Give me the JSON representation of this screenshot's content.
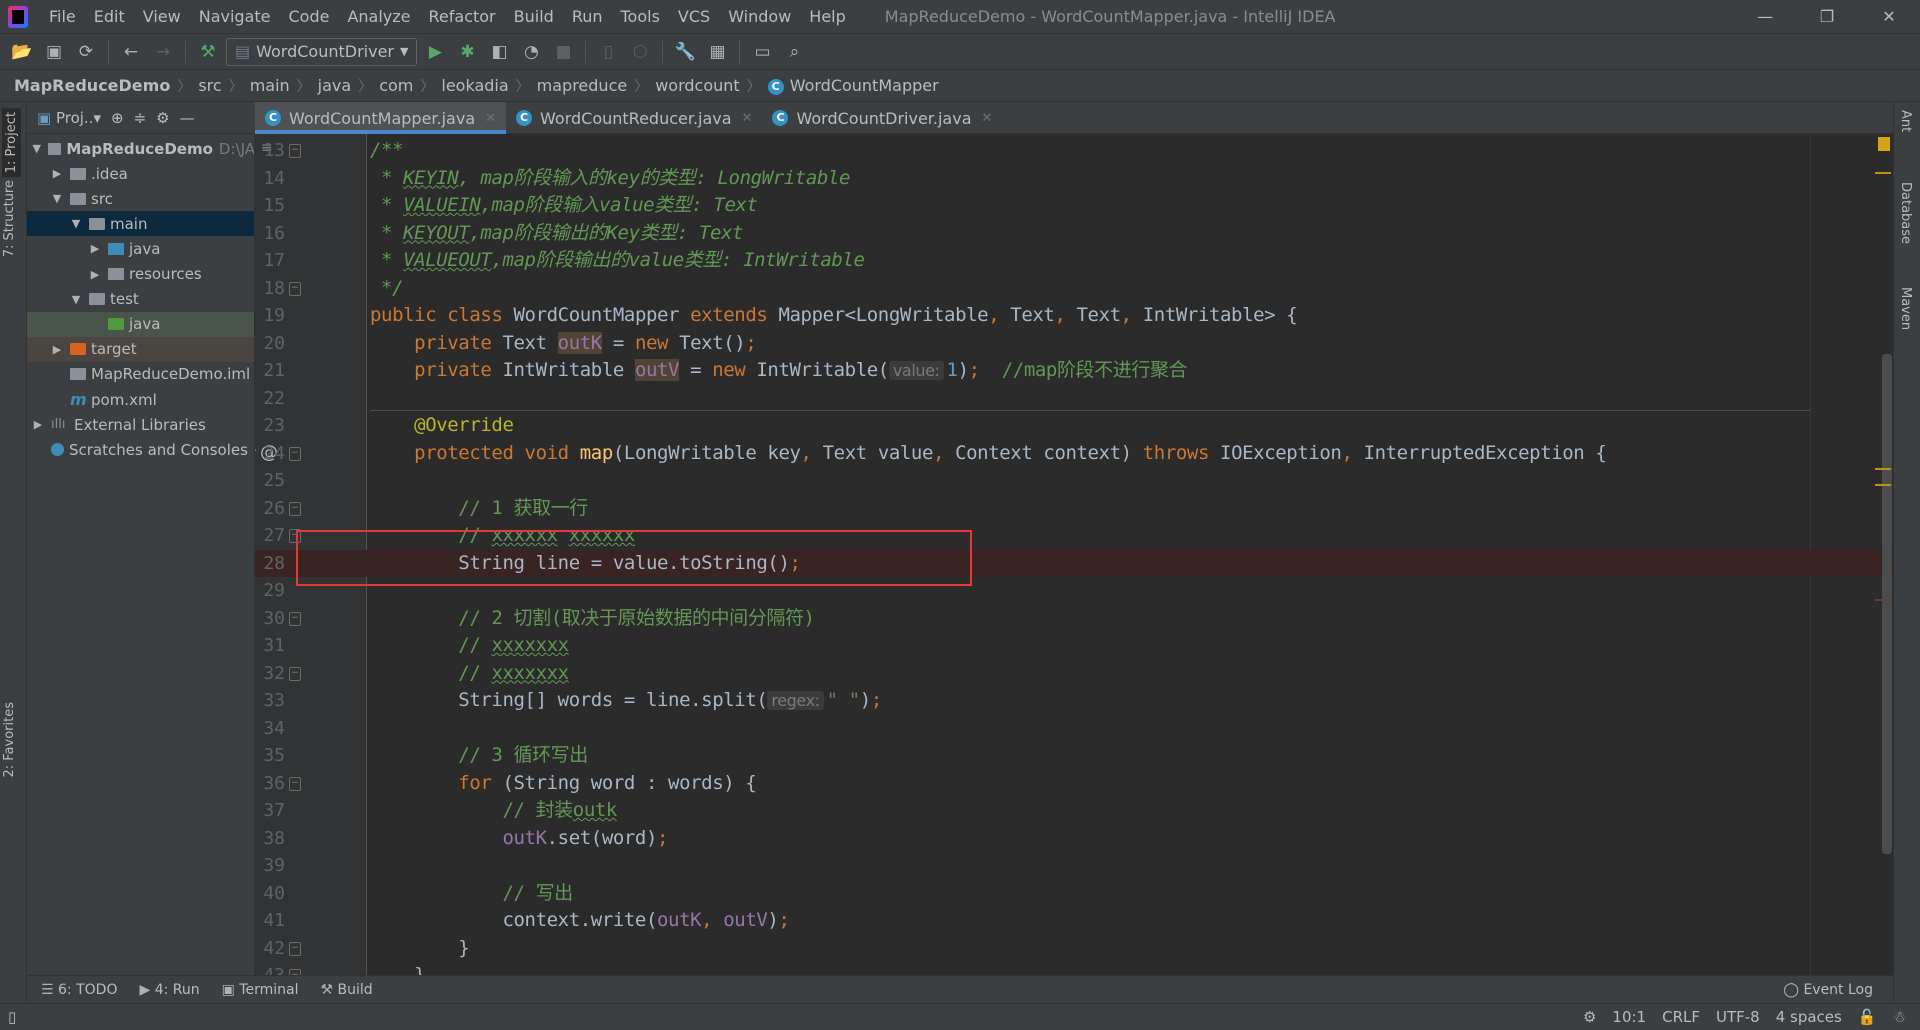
{
  "window": {
    "title": "MapReduceDemo - WordCountMapper.java - IntelliJ IDEA",
    "controls": [
      "—",
      "❐",
      "✕"
    ]
  },
  "menu": [
    "File",
    "Edit",
    "View",
    "Navigate",
    "Code",
    "Analyze",
    "Refactor",
    "Build",
    "Run",
    "Tools",
    "VCS",
    "Window",
    "Help"
  ],
  "toolbar": {
    "run_config": "WordCountDriver"
  },
  "breadcrumb": [
    "MapReduceDemo",
    "src",
    "main",
    "java",
    "com",
    "leokadia",
    "mapreduce",
    "wordcount",
    "WordCountMapper"
  ],
  "left_strip": {
    "project": "1: Project",
    "structure": "7: Structure",
    "favorites": "2: Favorites"
  },
  "right_strip": {
    "ant": "Ant",
    "database": "Database",
    "maven": "Maven"
  },
  "project_panel": {
    "header": "Proj..",
    "tree": [
      {
        "label": "MapReduceDemo",
        "extra": "D:\\JA",
        "depth": 0,
        "arrow": "down",
        "icon": "module-folder",
        "bold": true
      },
      {
        "label": ".idea",
        "depth": 1,
        "arrow": "right",
        "icon": "folder"
      },
      {
        "label": "src",
        "depth": 1,
        "arrow": "down",
        "icon": "folder"
      },
      {
        "label": "main",
        "depth": 2,
        "arrow": "down",
        "icon": "folder",
        "state": "selected"
      },
      {
        "label": "java",
        "depth": 3,
        "arrow": "right",
        "icon": "source-folder"
      },
      {
        "label": "resources",
        "depth": 3,
        "arrow": "right",
        "icon": "resources-folder"
      },
      {
        "label": "test",
        "depth": 2,
        "arrow": "down",
        "icon": "folder"
      },
      {
        "label": "java",
        "depth": 3,
        "arrow": "",
        "icon": "test-folder",
        "state": "test"
      },
      {
        "label": "target",
        "depth": 1,
        "arrow": "right",
        "icon": "excluded-folder",
        "state": "excluded"
      },
      {
        "label": "MapReduceDemo.iml",
        "depth": 1,
        "arrow": "",
        "icon": "iml-file"
      },
      {
        "label": "pom.xml",
        "depth": 1,
        "arrow": "",
        "icon": "maven-file"
      },
      {
        "label": "External Libraries",
        "depth": 0,
        "arrow": "right",
        "icon": "libraries"
      },
      {
        "label": "Scratches and Consoles",
        "depth": 0,
        "arrow": "",
        "icon": "scratches"
      }
    ]
  },
  "tabs": [
    {
      "label": "WordCountMapper.java",
      "active": true
    },
    {
      "label": "WordCountReducer.java",
      "active": false
    },
    {
      "label": "WordCountDriver.java",
      "active": false
    }
  ],
  "editor": {
    "breakpoint_line": 28,
    "lines": [
      {
        "n": "13",
        "t": [
          [
            "/**",
            "doc"
          ]
        ]
      },
      {
        "n": "14",
        "t": [
          [
            " * ",
            "doc"
          ],
          [
            "KEYIN",
            "doc ul"
          ],
          [
            ", map阶段输入的key的类型: LongWritable",
            "doc"
          ]
        ]
      },
      {
        "n": "15",
        "t": [
          [
            " * ",
            "doc"
          ],
          [
            "VALUEIN",
            "doc ul"
          ],
          [
            ",map阶段输入value类型: Text",
            "doc"
          ]
        ]
      },
      {
        "n": "16",
        "t": [
          [
            " * ",
            "doc"
          ],
          [
            "KEYOUT",
            "doc ul"
          ],
          [
            ",map阶段输出的Key类型: Text",
            "doc"
          ]
        ]
      },
      {
        "n": "17",
        "t": [
          [
            " * ",
            "doc"
          ],
          [
            "VALUEOUT",
            "doc ul"
          ],
          [
            ",map阶段输出的value类型: IntWritable",
            "doc"
          ]
        ]
      },
      {
        "n": "18",
        "t": [
          [
            " */",
            "doc"
          ]
        ]
      },
      {
        "n": "19",
        "t": [
          [
            "public class ",
            "kw"
          ],
          [
            "WordCountMapper ",
            "tx"
          ],
          [
            "extends ",
            "kw"
          ],
          [
            "Mapper<LongWritable",
            "tx"
          ],
          [
            ", ",
            "kw"
          ],
          [
            "Text",
            "tx"
          ],
          [
            ", ",
            "kw"
          ],
          [
            "Text",
            "tx"
          ],
          [
            ", ",
            "kw"
          ],
          [
            "IntWritable> {",
            "tx"
          ]
        ]
      },
      {
        "n": "20",
        "t": [
          [
            "    private ",
            "kw"
          ],
          [
            "Text ",
            "tx"
          ],
          [
            "outK",
            "fd hl"
          ],
          [
            " = ",
            "tx"
          ],
          [
            "new ",
            "kw"
          ],
          [
            "Text()",
            "tx"
          ],
          [
            ";",
            "kw"
          ]
        ]
      },
      {
        "n": "21",
        "t": [
          [
            "    private ",
            "kw"
          ],
          [
            "IntWritable ",
            "tx"
          ],
          [
            "outV",
            "fd hl"
          ],
          [
            " = ",
            "tx"
          ],
          [
            "new ",
            "kw"
          ],
          [
            "IntWritable(",
            "tx"
          ],
          [
            "value:",
            "hint"
          ],
          [
            "1",
            "nm"
          ],
          [
            ")",
            "tx"
          ],
          [
            ";",
            "kw"
          ],
          [
            "  //map阶段不进行聚合",
            "cm"
          ]
        ]
      },
      {
        "n": "22",
        "t": []
      },
      {
        "n": "23",
        "t": [
          [
            "    @Override",
            "an"
          ]
        ]
      },
      {
        "n": "24",
        "t": [
          [
            "    protected void ",
            "kw"
          ],
          [
            "map",
            "mt"
          ],
          [
            "(LongWritable key",
            "tx"
          ],
          [
            ", ",
            "kw"
          ],
          [
            "Text value",
            "tx"
          ],
          [
            ", ",
            "kw"
          ],
          [
            "Context context) ",
            "tx"
          ],
          [
            "throws ",
            "kw"
          ],
          [
            "IOException",
            "tx"
          ],
          [
            ", ",
            "kw"
          ],
          [
            "InterruptedException {",
            "tx"
          ]
        ]
      },
      {
        "n": "25",
        "t": []
      },
      {
        "n": "26",
        "t": [
          [
            "        // 1 获取一行",
            "cm"
          ]
        ]
      },
      {
        "n": "27",
        "t": [
          [
            "        // ",
            "cm"
          ],
          [
            "xxxxxx",
            "cm ul"
          ],
          [
            " ",
            "cm"
          ],
          [
            "xxxxxx",
            "cm ul"
          ]
        ]
      },
      {
        "n": "28",
        "t": [
          [
            "        String line = value.toString()",
            "tx"
          ],
          [
            ";",
            "kw"
          ]
        ]
      },
      {
        "n": "29",
        "t": []
      },
      {
        "n": "30",
        "t": [
          [
            "        // 2 切割(取决于原始数据的中间分隔符)",
            "cm"
          ]
        ]
      },
      {
        "n": "31",
        "t": [
          [
            "        // ",
            "cm"
          ],
          [
            "xxxxxxx",
            "cm ul"
          ]
        ]
      },
      {
        "n": "32",
        "t": [
          [
            "        // ",
            "cm"
          ],
          [
            "xxxxxxx",
            "cm ul"
          ]
        ]
      },
      {
        "n": "33",
        "t": [
          [
            "        String[] words = line.split(",
            "tx"
          ],
          [
            "regex:",
            "hint"
          ],
          [
            "\" \"",
            "st"
          ],
          [
            ")",
            "tx"
          ],
          [
            ";",
            "kw"
          ]
        ]
      },
      {
        "n": "34",
        "t": []
      },
      {
        "n": "35",
        "t": [
          [
            "        // 3 循环写出",
            "cm"
          ]
        ]
      },
      {
        "n": "36",
        "t": [
          [
            "        for ",
            "kw"
          ],
          [
            "(String word : words) {",
            "tx"
          ]
        ]
      },
      {
        "n": "37",
        "t": [
          [
            "            // 封装",
            "cm"
          ],
          [
            "outk",
            "cm ul"
          ]
        ]
      },
      {
        "n": "38",
        "t": [
          [
            "            ",
            "tx"
          ],
          [
            "outK",
            "fd"
          ],
          [
            ".set(word)",
            "tx"
          ],
          [
            ";",
            "kw"
          ]
        ]
      },
      {
        "n": "39",
        "t": []
      },
      {
        "n": "40",
        "t": [
          [
            "            // 写出",
            "cm"
          ]
        ]
      },
      {
        "n": "41",
        "t": [
          [
            "            context.write(",
            "tx"
          ],
          [
            "outK",
            "fd"
          ],
          [
            ", ",
            "kw"
          ],
          [
            "outV",
            "fd"
          ],
          [
            ")",
            "tx"
          ],
          [
            ";",
            "kw"
          ]
        ]
      },
      {
        "n": "42",
        "t": [
          [
            "        }",
            "tx"
          ]
        ]
      },
      {
        "n": "43",
        "t": [
          [
            "    }",
            "tx"
          ]
        ]
      }
    ]
  },
  "bottom_tools": [
    "6: TODO",
    "4: Run",
    "Terminal",
    "Build"
  ],
  "event_log": "Event Log",
  "status": {
    "position": "10:1",
    "line_sep": "CRLF",
    "encoding": "UTF-8",
    "indent": "4 spaces"
  }
}
